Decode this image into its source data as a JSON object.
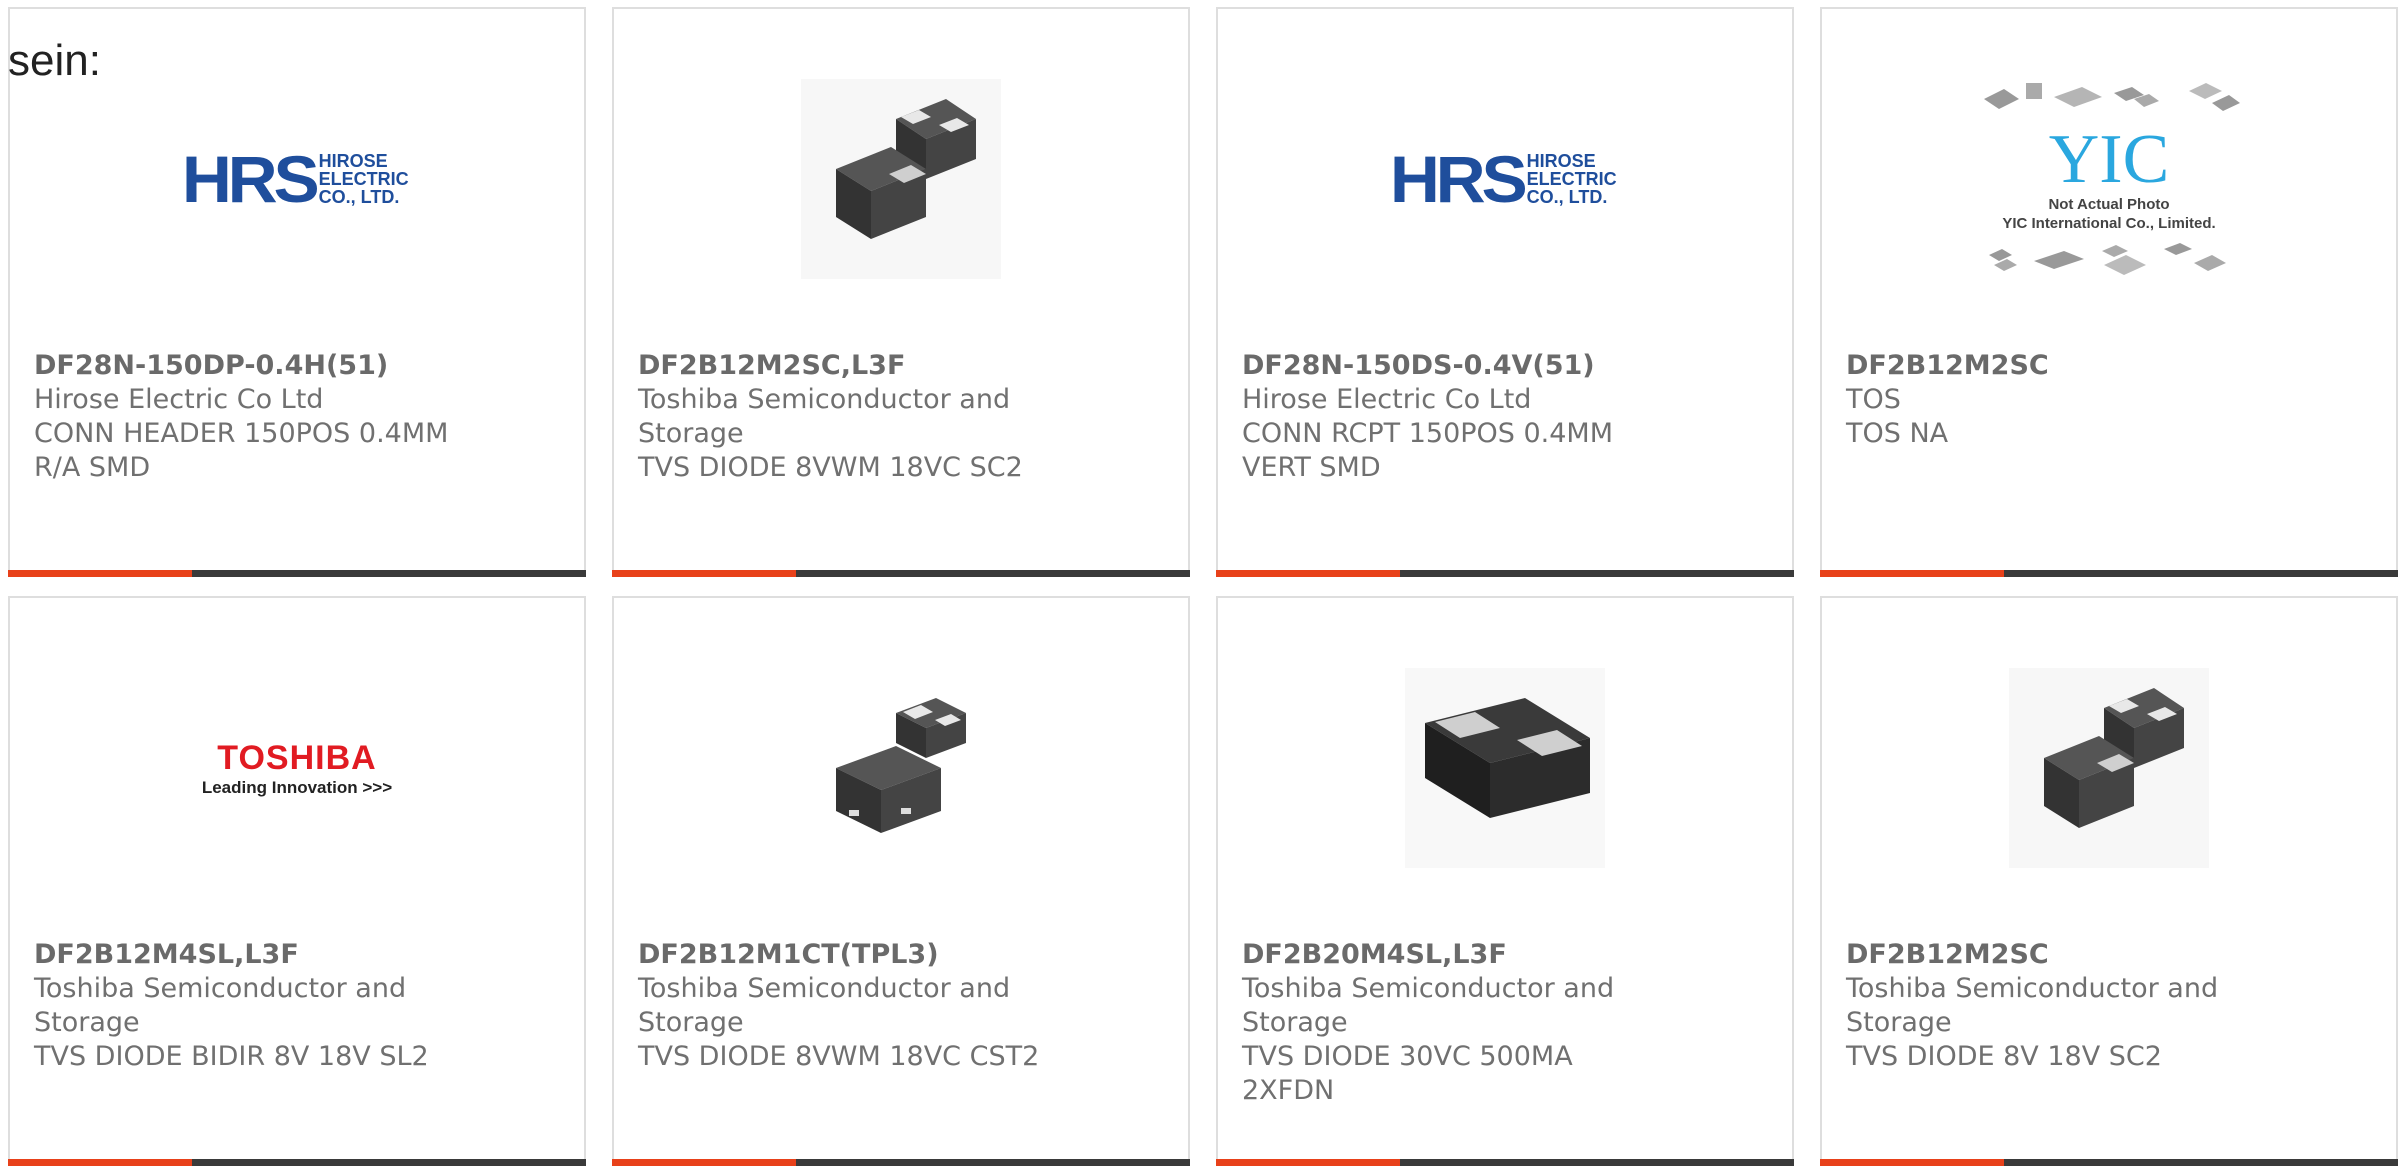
{
  "intro_text": "sein:",
  "products": [
    {
      "part_number": "DF28N-150DP-0.4H(51)",
      "manufacturer": "Hirose Electric Co Ltd",
      "description": "CONN HEADER 150POS 0.4MM R/A SMD",
      "image": "hirose-logo",
      "logo_lines": [
        "HIROSE",
        "ELECTRIC",
        "CO., LTD."
      ],
      "logo_mark": "HRS"
    },
    {
      "part_number": "DF2B12M2SC,L3F",
      "manufacturer": "Toshiba Semiconductor and Storage",
      "description": "TVS DIODE 8VWM 18VC SC2",
      "image": "two-chip-package-photo"
    },
    {
      "part_number": "DF28N-150DS-0.4V(51)",
      "manufacturer": "Hirose Electric Co Ltd",
      "description": "CONN RCPT 150POS 0.4MM VERT SMD",
      "image": "hirose-logo",
      "logo_lines": [
        "HIROSE",
        "ELECTRIC",
        "CO., LTD."
      ],
      "logo_mark": "HRS"
    },
    {
      "part_number": "DF2B12M2SC",
      "manufacturer": "TOS",
      "description": "TOS NA",
      "image": "yic-placeholder",
      "logo_mark": "YIC",
      "logo_lines": [
        "Not Actual Photo",
        "YIC International Co., Limited."
      ]
    },
    {
      "part_number": "DF2B12M4SL,L3F",
      "manufacturer": "Toshiba Semiconductor and Storage",
      "description": "TVS DIODE BIDIR 8V 18V SL2",
      "image": "toshiba-logo",
      "logo_mark": "TOSHIBA",
      "logo_lines": [
        "Leading Innovation >>>"
      ]
    },
    {
      "part_number": "DF2B12M1CT(TPL3)",
      "manufacturer": "Toshiba Semiconductor and Storage",
      "description": "TVS DIODE 8VWM 18VC CST2",
      "image": "two-chip-package-photo"
    },
    {
      "part_number": "DF2B20M4SL,L3F",
      "manufacturer": "Toshiba Semiconductor and Storage",
      "description": "TVS DIODE 30VC 500MA 2XFDN",
      "image": "single-chip-package-photo"
    },
    {
      "part_number": "DF2B12M2SC",
      "manufacturer": "Toshiba Semiconductor and Storage",
      "description": "TVS DIODE 8V 18V SC2",
      "image": "two-chip-package-photo"
    }
  ],
  "colors": {
    "accent": "#e8411a",
    "bar": "#3a3a3a",
    "text": "#707070",
    "hirose_blue": "#1f4e9c",
    "toshiba_red": "#e11b22",
    "yic_blue": "#2aa7df"
  }
}
